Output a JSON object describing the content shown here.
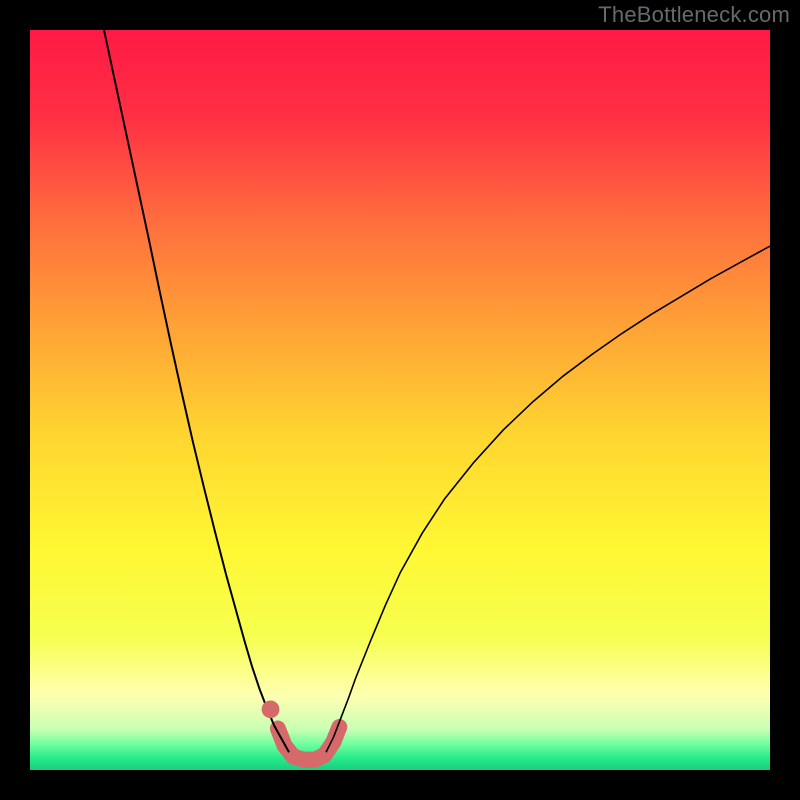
{
  "watermark": "TheBottleneck.com",
  "chart_data": {
    "type": "line",
    "title": "",
    "xlabel": "",
    "ylabel": "",
    "xlim": [
      0,
      100
    ],
    "ylim": [
      0,
      100
    ],
    "background_gradient": {
      "stops": [
        {
          "offset": 0.0,
          "color": "#ff1a45"
        },
        {
          "offset": 0.12,
          "color": "#ff3044"
        },
        {
          "offset": 0.25,
          "color": "#ff6a3e"
        },
        {
          "offset": 0.4,
          "color": "#ffa236"
        },
        {
          "offset": 0.55,
          "color": "#ffd630"
        },
        {
          "offset": 0.7,
          "color": "#fff733"
        },
        {
          "offset": 0.82,
          "color": "#f6ff4f"
        },
        {
          "offset": 0.9,
          "color": "#ffffb1"
        },
        {
          "offset": 0.945,
          "color": "#c8ffb4"
        },
        {
          "offset": 0.965,
          "color": "#70ff9e"
        },
        {
          "offset": 0.985,
          "color": "#25e98a"
        },
        {
          "offset": 1.0,
          "color": "#18ce7c"
        }
      ]
    },
    "series": [
      {
        "name": "left-branch",
        "stroke": "#000000",
        "stroke_width": 2.0,
        "points": [
          {
            "x": 10.0,
            "y": 100.0
          },
          {
            "x": 11.5,
            "y": 93.0
          },
          {
            "x": 13.0,
            "y": 86.0
          },
          {
            "x": 14.5,
            "y": 79.0
          },
          {
            "x": 16.0,
            "y": 72.0
          },
          {
            "x": 17.5,
            "y": 64.8
          },
          {
            "x": 19.0,
            "y": 57.8
          },
          {
            "x": 20.5,
            "y": 51.0
          },
          {
            "x": 22.0,
            "y": 44.4
          },
          {
            "x": 23.5,
            "y": 38.2
          },
          {
            "x": 25.0,
            "y": 32.2
          },
          {
            "x": 26.5,
            "y": 26.4
          },
          {
            "x": 28.0,
            "y": 21.0
          },
          {
            "x": 29.0,
            "y": 17.4
          },
          {
            "x": 30.0,
            "y": 14.0
          },
          {
            "x": 31.0,
            "y": 11.0
          },
          {
            "x": 32.0,
            "y": 8.4
          },
          {
            "x": 33.0,
            "y": 6.0
          },
          {
            "x": 34.0,
            "y": 4.2
          },
          {
            "x": 35.0,
            "y": 2.4
          }
        ]
      },
      {
        "name": "right-branch",
        "stroke": "#000000",
        "stroke_width": 1.6,
        "points": [
          {
            "x": 40.0,
            "y": 2.4
          },
          {
            "x": 41.0,
            "y": 4.4
          },
          {
            "x": 42.0,
            "y": 7.0
          },
          {
            "x": 43.0,
            "y": 9.6
          },
          {
            "x": 44.0,
            "y": 12.4
          },
          {
            "x": 46.0,
            "y": 17.4
          },
          {
            "x": 48.0,
            "y": 22.2
          },
          {
            "x": 50.0,
            "y": 26.6
          },
          {
            "x": 53.0,
            "y": 32.0
          },
          {
            "x": 56.0,
            "y": 36.6
          },
          {
            "x": 60.0,
            "y": 41.6
          },
          {
            "x": 64.0,
            "y": 46.0
          },
          {
            "x": 68.0,
            "y": 49.8
          },
          {
            "x": 72.0,
            "y": 53.2
          },
          {
            "x": 76.0,
            "y": 56.2
          },
          {
            "x": 80.0,
            "y": 59.0
          },
          {
            "x": 84.0,
            "y": 61.6
          },
          {
            "x": 88.0,
            "y": 64.0
          },
          {
            "x": 92.0,
            "y": 66.4
          },
          {
            "x": 96.0,
            "y": 68.6
          },
          {
            "x": 100.0,
            "y": 70.8
          }
        ]
      },
      {
        "name": "valley-highlight",
        "stroke": "#d66a6a",
        "stroke_width": 16,
        "linecap": "round",
        "points": [
          {
            "x": 33.5,
            "y": 5.6
          },
          {
            "x": 34.4,
            "y": 3.3
          },
          {
            "x": 35.6,
            "y": 1.8
          },
          {
            "x": 37.0,
            "y": 1.4
          },
          {
            "x": 38.5,
            "y": 1.4
          },
          {
            "x": 39.8,
            "y": 2.0
          },
          {
            "x": 41.0,
            "y": 3.8
          },
          {
            "x": 41.8,
            "y": 5.8
          }
        ]
      }
    ],
    "markers": [
      {
        "name": "valley-dot",
        "x": 32.5,
        "y": 8.2,
        "r": 1.2,
        "color": "#d66a6a"
      }
    ]
  }
}
